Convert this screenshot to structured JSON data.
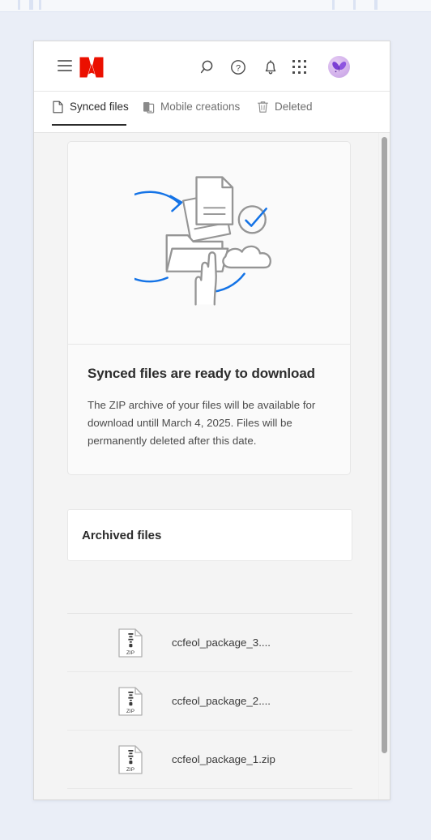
{
  "browser_chrome": {
    "tick_positions_left": [
      22,
      36,
      48
    ],
    "tick_positions_right": [
      406,
      434,
      460
    ]
  },
  "app": {
    "header": {
      "menu_icon": "hamburger-icon",
      "logo": "adobe-logo",
      "logo_color": "#eb1000",
      "actions": [
        {
          "name": "search-icon",
          "label": "Search"
        },
        {
          "name": "help-icon",
          "label": "Help"
        },
        {
          "name": "bell-icon",
          "label": "Notifications"
        },
        {
          "name": "apps-grid-icon",
          "label": "Apps"
        },
        {
          "name": "avatar",
          "label": "Account"
        }
      ]
    },
    "tabs": [
      {
        "id": "synced-files",
        "label": "Synced files",
        "icon": "document-icon",
        "active": true
      },
      {
        "id": "mobile-creations",
        "label": "Mobile creations",
        "icon": "mobile-devices-icon",
        "active": false
      },
      {
        "id": "deleted",
        "label": "Deleted",
        "icon": "trash-icon",
        "active": false
      }
    ],
    "hero": {
      "illustration": "sync-documents-cloud-illustration",
      "title": "Synced files are ready to download",
      "body": "The ZIP archive of your files will be available for download untill March 4, 2025. Files will be permanently deleted after this date."
    },
    "archived": {
      "title": "Archived files"
    },
    "files": [
      {
        "icon": "zip-file-icon",
        "badge": "ZIP",
        "name": "ccfeol_package_3...."
      },
      {
        "icon": "zip-file-icon",
        "badge": "ZIP",
        "name": "ccfeol_package_2...."
      },
      {
        "icon": "zip-file-icon",
        "badge": "ZIP",
        "name": "ccfeol_package_1.zip"
      }
    ],
    "scrollbar": {
      "name": "vertical-scrollbar",
      "thumb_color": "#a6a6a6"
    }
  },
  "colors": {
    "page_background": "#eaeef7",
    "window_background": "#f4f4f4",
    "accent_blue": "#1473e6",
    "illustration_gray": "#959595",
    "adobe_red": "#eb1000",
    "text_primary": "#2c2c2c",
    "text_secondary": "#707070"
  }
}
